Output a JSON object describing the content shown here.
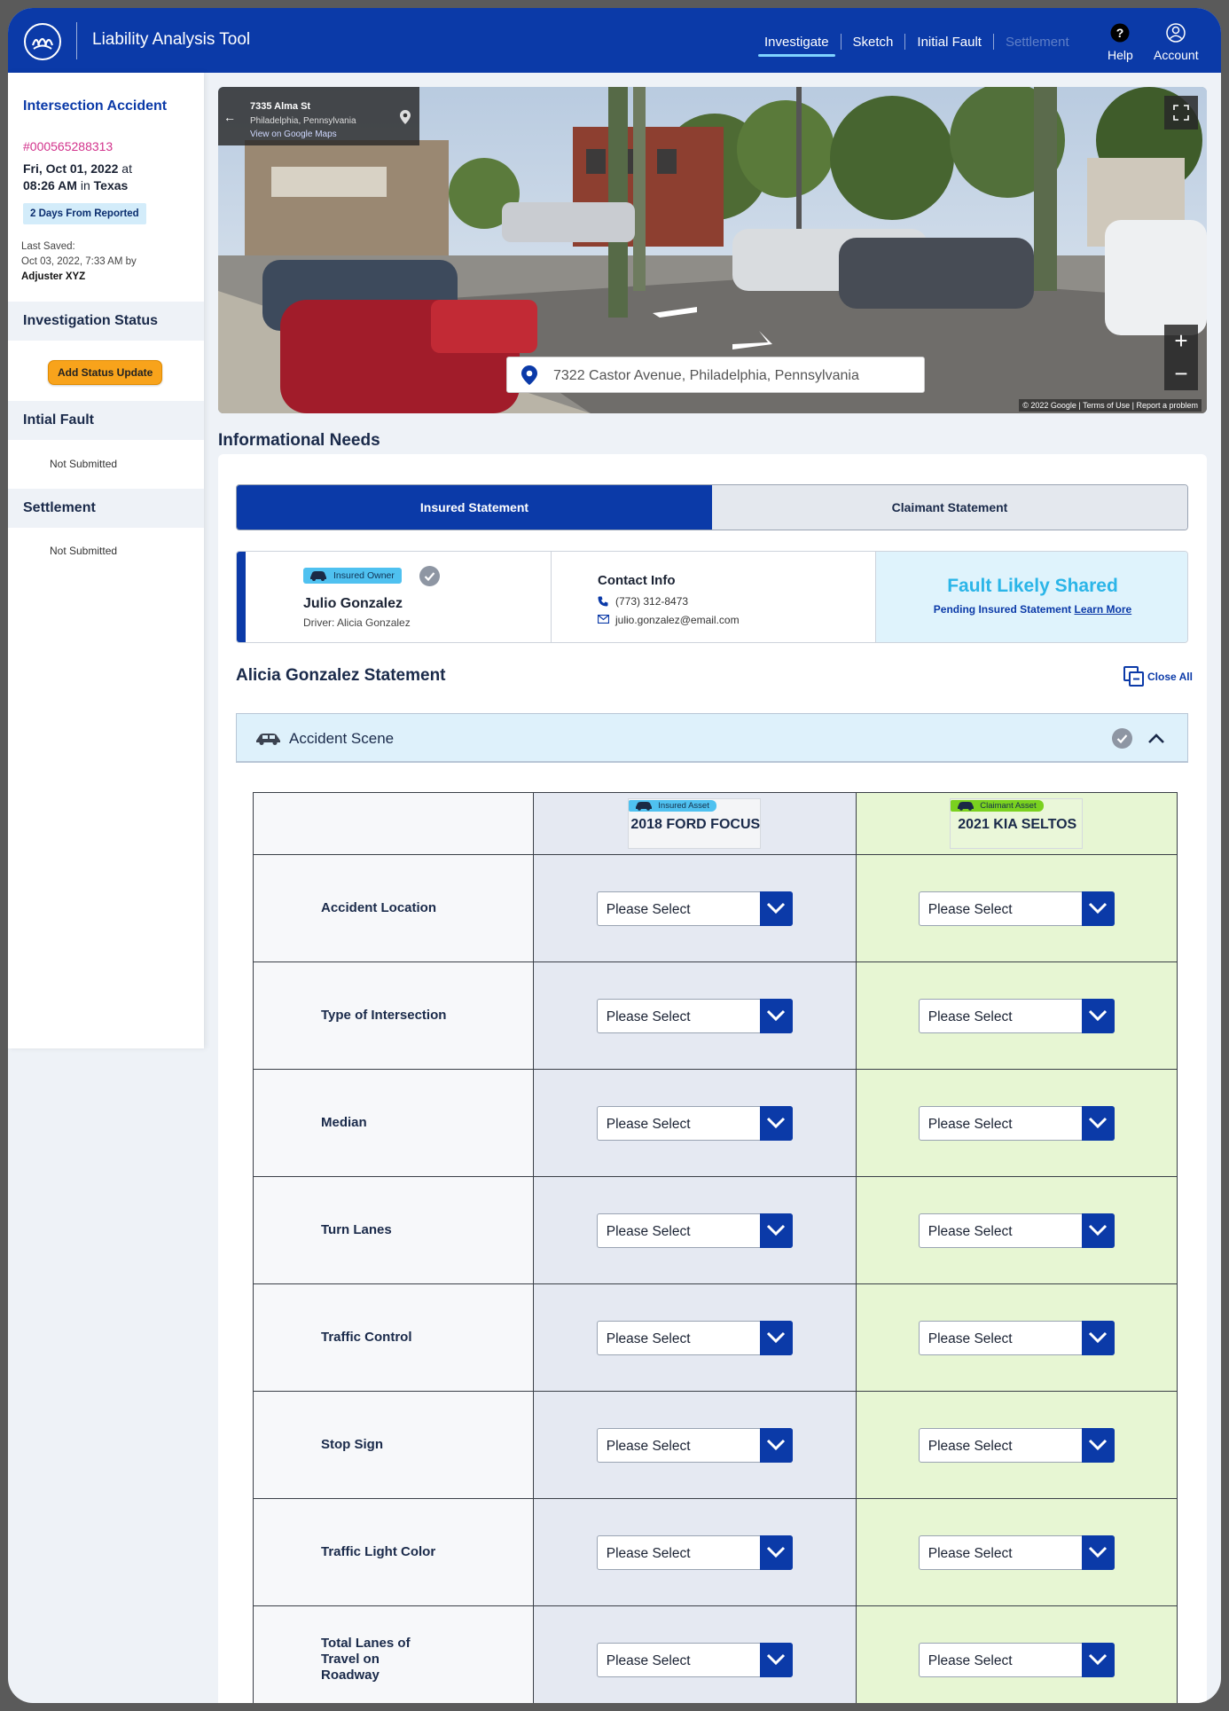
{
  "header": {
    "app_title": "Liability Analysis Tool",
    "tabs": [
      {
        "label": "Investigate",
        "state": "active"
      },
      {
        "label": "Sketch",
        "state": "normal"
      },
      {
        "label": "Initial Fault",
        "state": "normal"
      },
      {
        "label": "Settlement",
        "state": "disabled"
      }
    ],
    "help_label": "Help",
    "account_label": "Account",
    "brand_color": "#0b3aa8"
  },
  "sidebar": {
    "title": "Intersection Accident",
    "claim_number": "#000565288313",
    "date_line1": "Fri, Oct 01, 2022",
    "date_at": "at",
    "time": "08:26 AM",
    "time_in": "in",
    "state": "Texas",
    "days_badge": "2 Days From Reported",
    "last_saved_label": "Last Saved:",
    "last_saved_value": "Oct 03, 2022, 7:33 AM by",
    "last_saved_by": "Adjuster XYZ",
    "sections": [
      {
        "title": "Investigation Status",
        "action": "Add Status Update"
      },
      {
        "title": "Intial Fault",
        "status": "Not Submitted"
      },
      {
        "title": "Settlement",
        "status": "Not Submitted"
      }
    ]
  },
  "map": {
    "place_title": "7335 Alma St",
    "place_sub": "Philadelphia, Pennsylvania",
    "place_link": "View on Google Maps",
    "address": "7322 Castor Avenue, Philadelphia, Pennsylvania",
    "credit": "© 2022 Google  |  Terms of Use  |  Report a problem",
    "zoom_in": "+",
    "zoom_out": "−"
  },
  "info": {
    "heading": "Informational Needs",
    "tabs": [
      {
        "label": "Insured Statement",
        "active": true
      },
      {
        "label": "Claimant Statement",
        "active": false
      }
    ],
    "owner": {
      "badge": "Insured Owner",
      "name": "Julio Gonzalez",
      "driver": "Driver: Alicia Gonzalez"
    },
    "contact": {
      "heading": "Contact Info",
      "phone": "(773) 312-8473",
      "email": "julio.gonzalez@email.com"
    },
    "fault": {
      "title": "Fault Likely Shared",
      "subtitle": "Pending Insured Statement",
      "link": "Learn More"
    },
    "statement_title": "Alicia Gonzalez Statement",
    "close_all": "Close All",
    "accordion_title": "Accident Scene"
  },
  "table": {
    "insured": {
      "tag": "Insured Asset",
      "name": "2018 FORD FOCUS"
    },
    "claimant": {
      "tag": "Claimant Asset",
      "name": "2021 KIA SELTOS"
    },
    "placeholder": "Please Select",
    "rows": [
      {
        "label": "Accident Location"
      },
      {
        "label": "Type of Intersection"
      },
      {
        "label": "Median"
      },
      {
        "label": "Turn Lanes"
      },
      {
        "label": "Traffic Control"
      },
      {
        "label": "Stop Sign"
      },
      {
        "label": "Traffic Light Color"
      },
      {
        "label": "Total Lanes of Travel on Roadway"
      }
    ]
  }
}
